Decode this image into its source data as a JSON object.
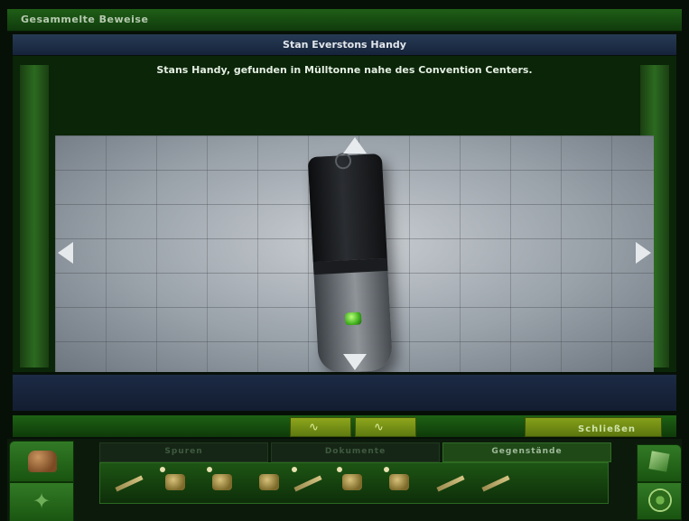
{
  "window": {
    "title": "Gesammelte Beweise"
  },
  "evidence": {
    "name": "Stan Everstons Handy",
    "description": "Stans Handy, gefunden in Mülltonne nahe des Convention Centers."
  },
  "toolbar": {
    "rotate_left_glyph": "∿",
    "rotate_right_glyph": "∿",
    "close_label": "Schließen"
  },
  "inventory": {
    "tabs": [
      {
        "label": "Spuren",
        "active": false
      },
      {
        "label": "Dokumente",
        "active": false
      },
      {
        "label": "Gegenstände",
        "active": true
      }
    ],
    "items": [
      {
        "icon": "crowbar-icon"
      },
      {
        "icon": "flask-icon"
      },
      {
        "icon": "nugget-icon"
      },
      {
        "icon": "pouch-icon"
      },
      {
        "icon": "gun-icon"
      },
      {
        "icon": "nugget-icon"
      },
      {
        "icon": "nugget-icon"
      },
      {
        "icon": "knife-icon"
      },
      {
        "icon": "tube-icon"
      }
    ]
  },
  "colors": {
    "frame_green": "#1f5f17",
    "name_bar_blue": "#273b55",
    "button_olive": "#86a01a"
  }
}
